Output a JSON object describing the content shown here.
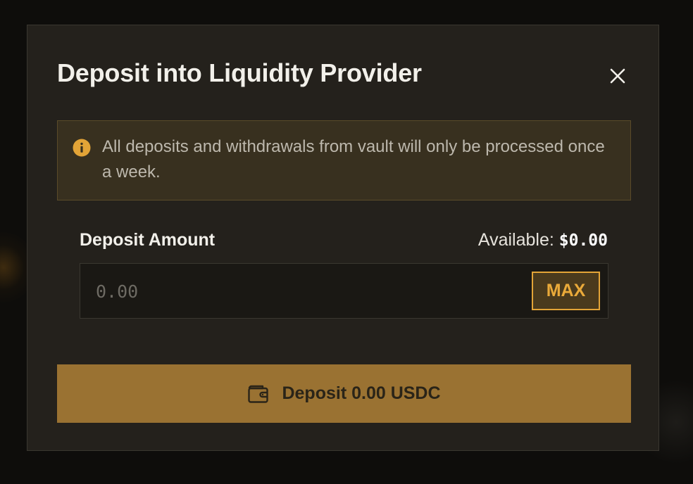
{
  "modal": {
    "title": "Deposit into Liquidity Provider",
    "close_icon": "close-icon"
  },
  "notice": {
    "icon": "info-icon",
    "text": "All deposits and withdrawals from vault will only be processed once a week.",
    "accent_color": "#e3a437"
  },
  "form": {
    "amount_label": "Deposit Amount",
    "available_label": "Available:",
    "available_value": "$0.00",
    "input_placeholder": "0.00",
    "input_value": "",
    "max_label": "MAX"
  },
  "action": {
    "icon": "wallet-icon",
    "label": "Deposit 0.00 USDC",
    "color": "#9a7232"
  }
}
